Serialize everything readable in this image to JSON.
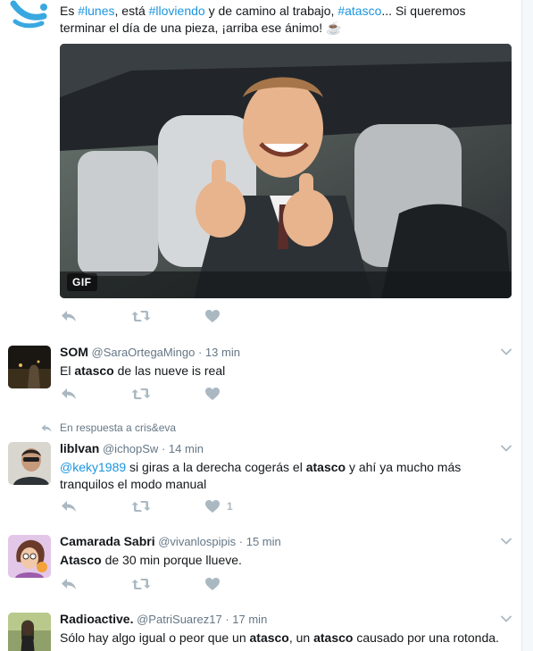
{
  "tweets": [
    {
      "text_parts": [
        "Es ",
        "#lunes",
        ", está ",
        "#lloviendo",
        " y de camino al trabajo, ",
        "#atasco",
        "... Si queremos terminar el día de una pieza, ¡arriba ese ánimo! ☕"
      ],
      "media_badge": "GIF",
      "likes": ""
    },
    {
      "name": "SOM",
      "handle": "@SaraOrtegaMingo",
      "sep": "·",
      "time": "13 min",
      "text_parts": [
        "El ",
        "atasco",
        " de las nueve is real"
      ]
    },
    {
      "reply_context": "En respuesta a cris&eva",
      "name": "liblvan",
      "handle": "@ichopSw",
      "sep": "·",
      "time": "14 min",
      "text_parts": [
        "@keky1989",
        " si giras a la derecha cogerás el ",
        "atasco",
        " y ahí ya mucho más tranquilos el modo manual"
      ],
      "likes": "1"
    },
    {
      "name": "Camarada Sabri",
      "handle": "@vivanlospipis",
      "sep": "·",
      "time": "15 min",
      "text_parts": [
        "Atasco",
        " de 30 min porque llueve."
      ]
    },
    {
      "name": "Radioactive.",
      "handle": "@PatriSuarez17",
      "sep": "·",
      "time": "17 min",
      "text_parts": [
        "Sólo hay algo igual o peor que un ",
        "atasco",
        ", un ",
        "atasco",
        " causado por una rotonda."
      ]
    }
  ],
  "icons": {
    "reply": "reply-icon",
    "retweet": "retweet-icon",
    "like": "heart-icon",
    "menu": "chevron-down-icon"
  },
  "colors": {
    "link": "#1b95e0",
    "action": "#aab8c2",
    "meta": "#657786",
    "text": "#14171a"
  }
}
